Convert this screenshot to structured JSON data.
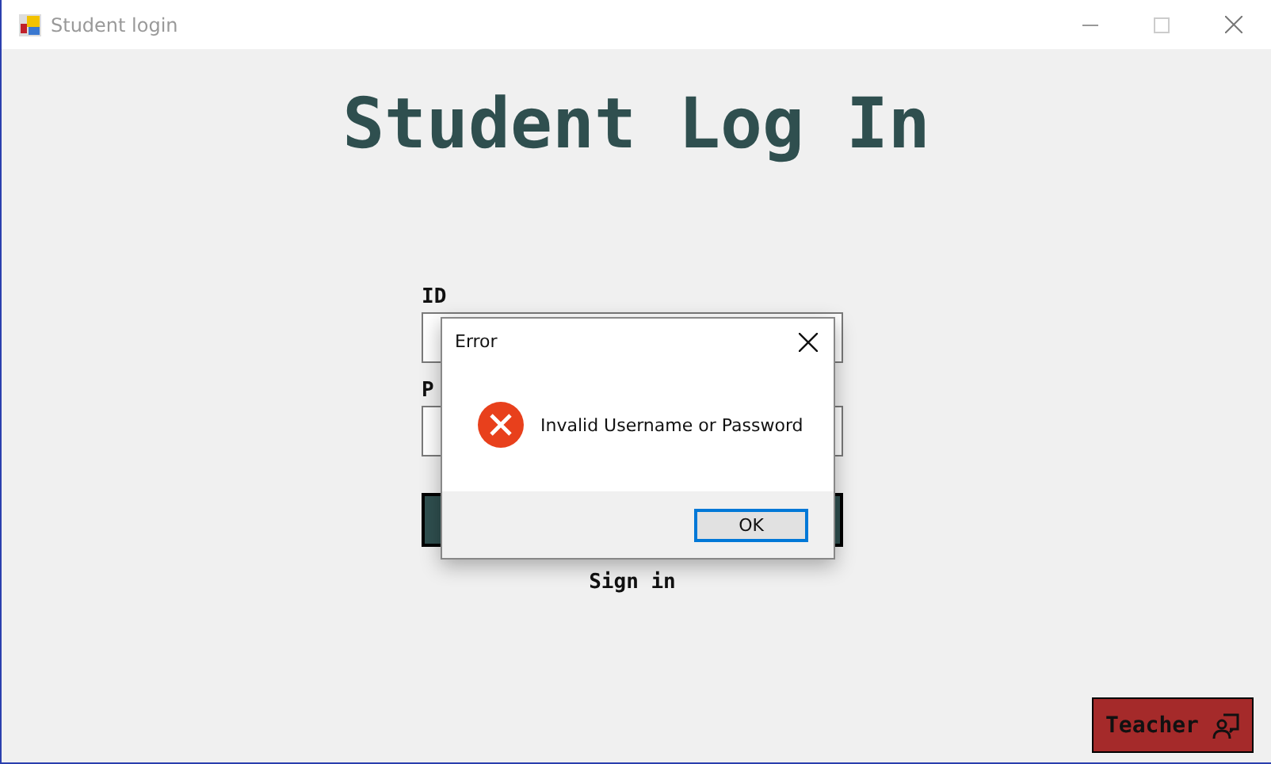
{
  "window": {
    "title": "Student login"
  },
  "heading": "Student Log In",
  "form": {
    "id_label": "ID",
    "password_label": "P",
    "sign_in_caption": "Sign in"
  },
  "teacher_button": "Teacher",
  "dialog": {
    "title": "Error",
    "message": "Invalid Username or Password",
    "button": "OK"
  }
}
